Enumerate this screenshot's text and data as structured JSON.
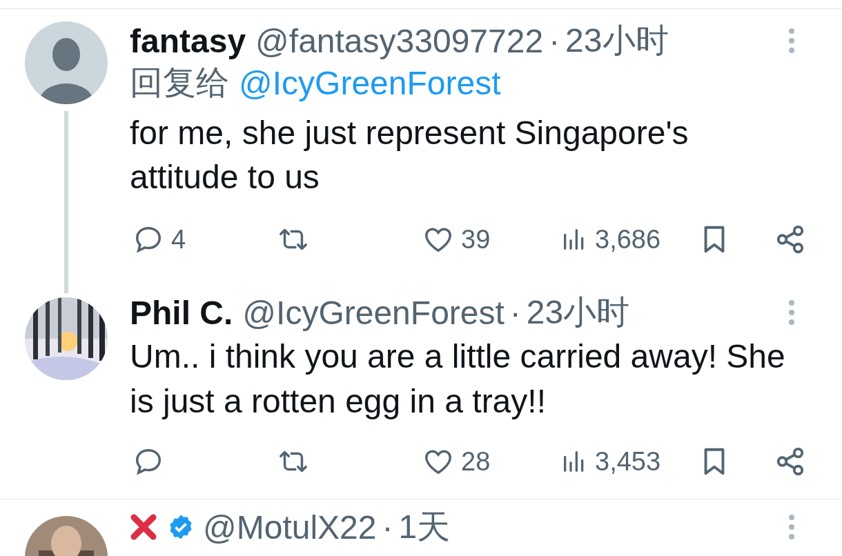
{
  "tweets": [
    {
      "avatar": {
        "kind": "default"
      },
      "name": "fantasy",
      "handle": "@fantasy33097722",
      "separator": "·",
      "time": "23小时",
      "reply_to_label": "回复给",
      "reply_to": "@IcyGreenForest",
      "text": "for me, she just represent Singapore's attitude to us",
      "thread_line": true,
      "replies": "4",
      "likes": "39",
      "views": "3,686"
    },
    {
      "name": "Phil C.",
      "handle": "@IcyGreenForest",
      "separator": "·",
      "time": "23小时",
      "text": "Um.. i think you are a little carried away! She is just a rotten egg in a tray!!",
      "thread_line": false,
      "likes": "28",
      "views": "3,453",
      "divider_below": true
    },
    {
      "name_mark": {
        "kind": "cross"
      },
      "verified": true,
      "handle": "@MotulX22",
      "separator": "·",
      "time": "1天",
      "thread_line": false
    }
  ]
}
